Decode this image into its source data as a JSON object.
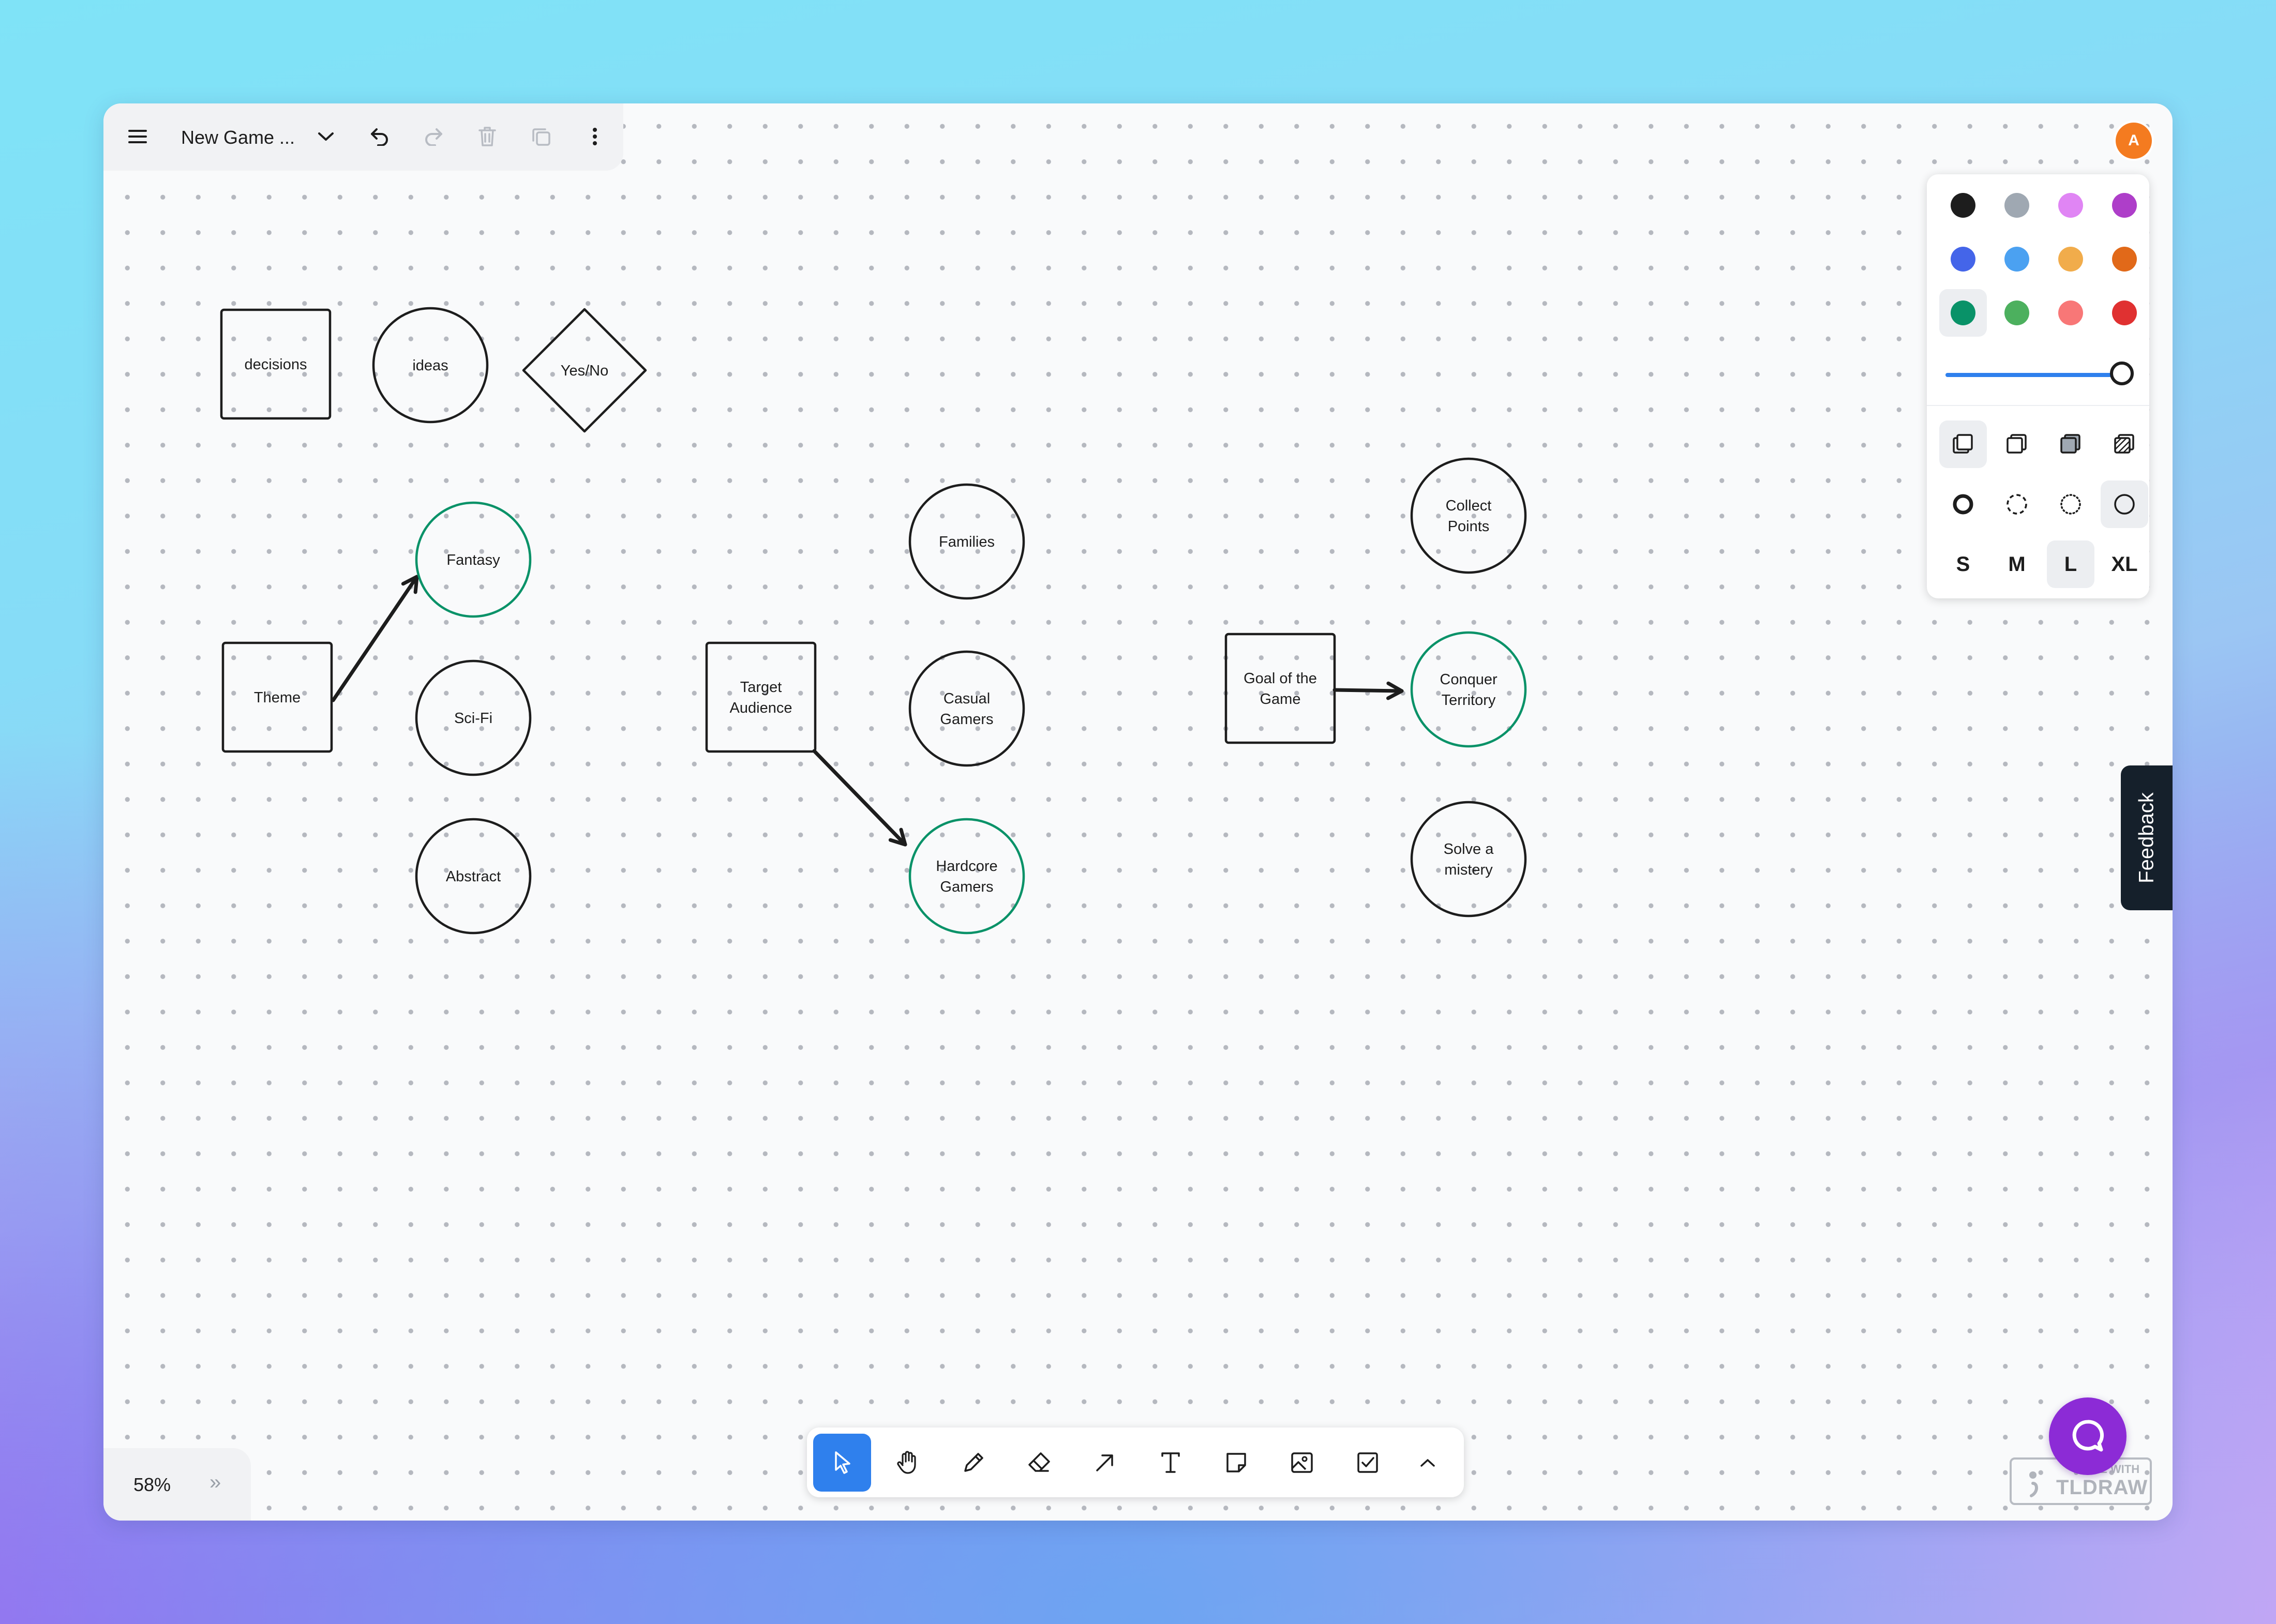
{
  "document": {
    "title": "New Game ..."
  },
  "user": {
    "avatar_initial": "A"
  },
  "canvas": {
    "shapes": [
      {
        "id": "decisions",
        "kind": "rectangle",
        "label": [
          "decisions"
        ],
        "stroke": "#1d1d1d"
      },
      {
        "id": "ideas",
        "kind": "ellipse",
        "label": [
          "ideas"
        ],
        "stroke": "#1d1d1d"
      },
      {
        "id": "yes-no",
        "kind": "diamond",
        "label": [
          "Yes/No"
        ],
        "stroke": "#1d1d1d"
      },
      {
        "id": "theme",
        "kind": "rectangle",
        "label": [
          "Theme"
        ],
        "stroke": "#1d1d1d"
      },
      {
        "id": "fantasy",
        "kind": "ellipse",
        "label": [
          "Fantasy"
        ],
        "stroke": "#099268"
      },
      {
        "id": "sci-fi",
        "kind": "ellipse",
        "label": [
          "Sci-Fi"
        ],
        "stroke": "#1d1d1d"
      },
      {
        "id": "abstract",
        "kind": "ellipse",
        "label": [
          "Abstract"
        ],
        "stroke": "#1d1d1d"
      },
      {
        "id": "target-audience",
        "kind": "rectangle",
        "label": [
          "Target",
          "Audience"
        ],
        "stroke": "#1d1d1d"
      },
      {
        "id": "families",
        "kind": "ellipse",
        "label": [
          "Families"
        ],
        "stroke": "#1d1d1d"
      },
      {
        "id": "casual-gamers",
        "kind": "ellipse",
        "label": [
          "Casual",
          "Gamers"
        ],
        "stroke": "#1d1d1d"
      },
      {
        "id": "hardcore-gamers",
        "kind": "ellipse",
        "label": [
          "Hardcore",
          "Gamers"
        ],
        "stroke": "#099268"
      },
      {
        "id": "goal-of-the-game",
        "kind": "rectangle",
        "label": [
          "Goal of the",
          "Game"
        ],
        "stroke": "#1d1d1d"
      },
      {
        "id": "collect-points",
        "kind": "ellipse",
        "label": [
          "Collect",
          "Points"
        ],
        "stroke": "#1d1d1d"
      },
      {
        "id": "conquer-territory",
        "kind": "ellipse",
        "label": [
          "Conquer",
          "Territory"
        ],
        "stroke": "#099268"
      },
      {
        "id": "solve-a-mistery",
        "kind": "ellipse",
        "label": [
          "Solve a",
          "mistery"
        ],
        "stroke": "#1d1d1d"
      }
    ],
    "arrows": [
      {
        "from": "theme",
        "to": "fantasy"
      },
      {
        "from": "target-audience",
        "to": "hardcore-gamers"
      },
      {
        "from": "goal-of-the-game",
        "to": "conquer-territory"
      }
    ]
  },
  "style_panel": {
    "colors": [
      {
        "name": "black",
        "hex": "#1d1d1d"
      },
      {
        "name": "grey",
        "hex": "#9fa8b2"
      },
      {
        "name": "light-violet",
        "hex": "#e085f4"
      },
      {
        "name": "violet",
        "hex": "#ae3ec9"
      },
      {
        "name": "blue",
        "hex": "#4465e9"
      },
      {
        "name": "light-blue",
        "hex": "#4ba1f1"
      },
      {
        "name": "yellow",
        "hex": "#f1ac4b"
      },
      {
        "name": "orange",
        "hex": "#e16919"
      },
      {
        "name": "green",
        "hex": "#099268"
      },
      {
        "name": "light-green",
        "hex": "#4cb05e"
      },
      {
        "name": "light-red",
        "hex": "#f87777"
      },
      {
        "name": "red",
        "hex": "#e03131"
      }
    ],
    "selected_color": "green",
    "opacity": 1.0,
    "fill_options": [
      "none",
      "semi",
      "solid",
      "pattern"
    ],
    "selected_fill": "none",
    "dash_options": [
      "draw",
      "dashed",
      "dotted",
      "solid"
    ],
    "selected_dash": "solid",
    "sizes": [
      "S",
      "M",
      "L",
      "XL"
    ],
    "selected_size": "L"
  },
  "feedback_label": "Feedback",
  "toolbar": {
    "tools": [
      "select",
      "hand",
      "draw",
      "eraser",
      "arrow",
      "text",
      "note",
      "asset",
      "checkbox",
      "more"
    ],
    "active_tool": "select"
  },
  "zoom": {
    "label": "58%"
  },
  "watermark": {
    "small": "MADE WITH",
    "big": "TLDRAW"
  },
  "accent": "#2f80ed"
}
